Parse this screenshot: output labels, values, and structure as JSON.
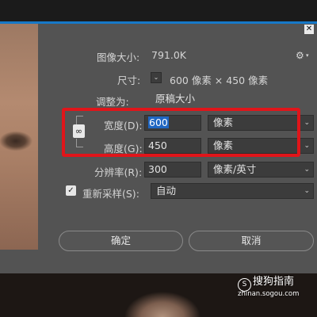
{
  "dialog": {
    "image_size_label": "图像大小:",
    "image_size_value": "791.0K",
    "dimensions_label": "尺寸:",
    "dimensions_value": "600 像素 × 450 像素",
    "fit_to_label": "调整为:",
    "fit_to_value": "原稿大小",
    "width_label": "宽度(D):",
    "width_value": "600",
    "width_unit": "像素",
    "height_label": "高度(G):",
    "height_value": "450",
    "height_unit": "像素",
    "resolution_label": "分辨率(R):",
    "resolution_value": "300",
    "resolution_unit": "像素/英寸",
    "resample_label": "重新采样(S):",
    "resample_value": "自动",
    "resample_checked": true,
    "ok_label": "确定",
    "cancel_label": "取消"
  },
  "icons": {
    "settings": "gear-icon",
    "dimensions_toggle": "chevron-down-icon",
    "constrain_proportions": "link-icon",
    "close": "close-icon"
  },
  "watermark": {
    "brand": "搜狗指南",
    "url": "zhinan.sogou.com",
    "logo_glyph": "S"
  },
  "colors": {
    "dialog_bg": "#535353",
    "highlight": "#e0151a",
    "selection": "#1f66c2"
  }
}
